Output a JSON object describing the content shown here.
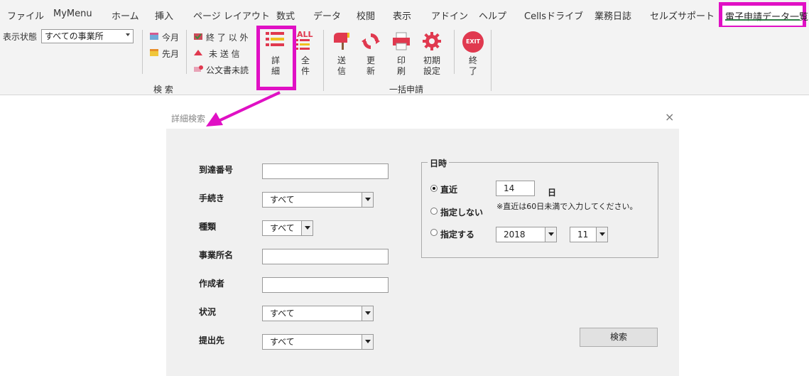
{
  "ribbon_tabs": [
    "ファイル",
    "MyMenu",
    "ホーム",
    "挿入",
    "ページ レイアウト",
    "数式",
    "データ",
    "校閲",
    "表示",
    "アドイン",
    "ヘルプ",
    "Cellsドライブ",
    "業務日誌",
    "セルズサポート"
  ],
  "active_tab": "電子申請データ一覧",
  "ribbon": {
    "display_status_label": "表示状態",
    "display_status_value": "すべての事業所",
    "this_month": "今月",
    "last_month": "先月",
    "finished_other": "終 了 以 外",
    "unsent": "未 送 信",
    "unread_docs": "公文書未読",
    "detail_line1": "詳",
    "detail_line2": "細",
    "all_line1": "全",
    "all_line2": "件",
    "all_badge": "ALL",
    "search_group": "検 索",
    "send_line1": "送",
    "send_line2": "信",
    "update_line1": "更",
    "update_line2": "新",
    "print_line1": "印",
    "print_line2": "刷",
    "settings_line1": "初期",
    "settings_line2": "設定",
    "batch_group": "一括申請",
    "exit_line1": "終",
    "exit_line2": "了",
    "exit_badge": "EXIT"
  },
  "dialog": {
    "title": "詳細検索",
    "close": "×",
    "fields": {
      "arrival_no_label": "到達番号",
      "procedure_label": "手続き",
      "procedure_value": "すべて",
      "type_label": "種類",
      "type_value": "すべて",
      "office_label": "事業所名",
      "author_label": "作成者",
      "status_label": "状況",
      "status_value": "すべて",
      "submit_to_label": "提出先",
      "submit_to_value": "すべて"
    },
    "datetime": {
      "title": "日時",
      "recent_label": "直近",
      "recent_value": "14",
      "day_unit": "日",
      "note": "※直近は60日未満で入力してください。",
      "none_label": "指定しない",
      "specify_label": "指定する",
      "year_value": "2018",
      "month_value": "11",
      "selected": "recent"
    },
    "search_button": "検索"
  },
  "colors": {
    "highlight": "#e010c4",
    "accent_red": "#e0394f"
  }
}
